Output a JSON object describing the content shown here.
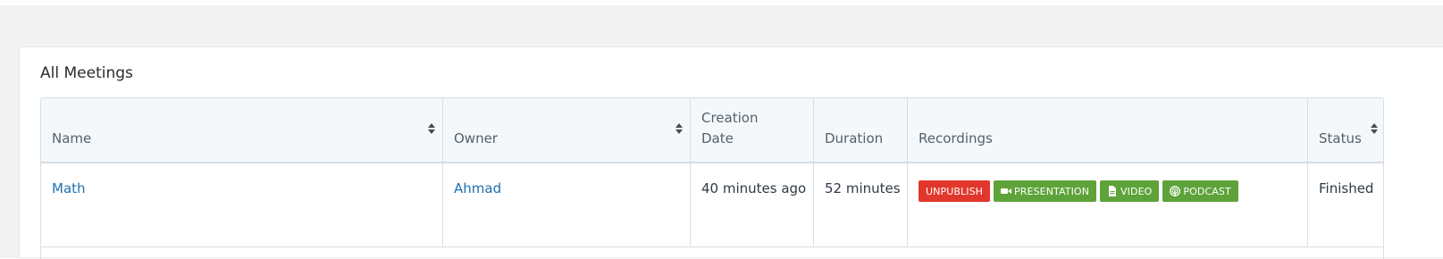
{
  "card": {
    "title": "All Meetings"
  },
  "table": {
    "headers": {
      "name": "Name",
      "owner": "Owner",
      "creation_date": "Creation Date",
      "duration": "Duration",
      "recordings": "Recordings",
      "status": "Status"
    },
    "rows": [
      {
        "name": "Math",
        "owner": "Ahmad",
        "creation_date": "40 minutes ago",
        "duration": "52 minutes",
        "recordings": {
          "unpublish": "UNPUBLISH",
          "presentation": "PRESENTATION",
          "video": "VIDEO",
          "podcast": "PODCAST"
        },
        "status": "Finished"
      }
    ]
  },
  "colors": {
    "unpublish": "#e2372c",
    "recording_format": "#5ea339",
    "link": "#1e6fb0",
    "header_bg": "#f5f8fa"
  },
  "icons": {
    "presentation": "video-camera-icon",
    "video": "file-icon",
    "podcast": "podcast-icon",
    "sort": "sort-icon"
  }
}
